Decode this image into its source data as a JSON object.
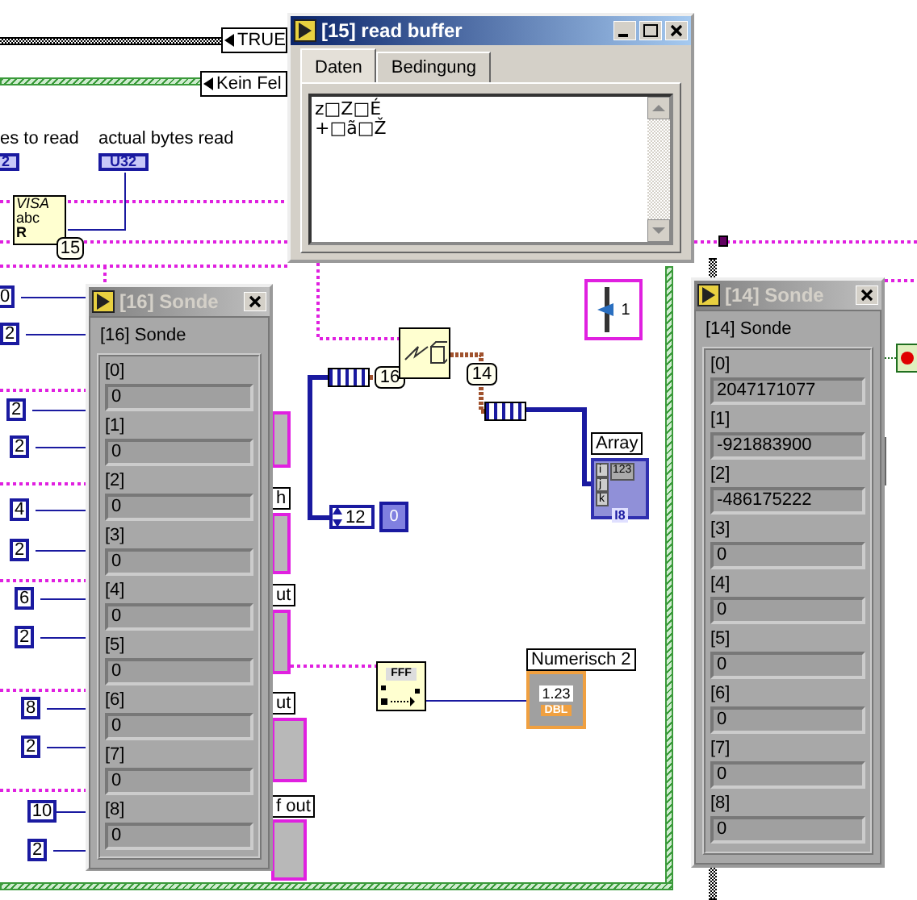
{
  "case_selectors": [
    {
      "label": "TRUE"
    },
    {
      "label": "Kein Fel"
    }
  ],
  "terminals": [
    {
      "label": "es to read",
      "value": "2"
    },
    {
      "label": "actual bytes read",
      "value": "U32"
    }
  ],
  "visa_read_node": {
    "lines": [
      "VISA",
      "abc",
      "R"
    ]
  },
  "probe_tags": [
    "15",
    "16",
    "14"
  ],
  "left_constants": [
    "0",
    "2",
    "2",
    "2",
    "4",
    "2",
    "6",
    "2",
    "8",
    "2",
    "10",
    "2"
  ],
  "string_indicator_labels": [
    "h",
    "ut",
    "ut",
    "f out"
  ],
  "slider_control": {
    "value": "1"
  },
  "numeric_control": {
    "value": "12",
    "index": "0"
  },
  "array_indicator": {
    "label": "Array",
    "value": "123",
    "indices": [
      "i",
      "j",
      "k"
    ],
    "type": "I8"
  },
  "format_node": {
    "text": "FFF"
  },
  "numeric_indicator": {
    "label": "Numerisch 2",
    "value": "1.23",
    "type": "DBL"
  },
  "probe_windows": [
    {
      "kind": "text",
      "title": "[15] read buffer",
      "active": true,
      "tabs": [
        {
          "label": "Daten",
          "selected": true
        },
        {
          "label": "Bedingung",
          "selected": false
        }
      ],
      "lines": [
        "z□Z□É",
        "+□ã□Ž"
      ]
    },
    {
      "kind": "array",
      "title": "[16] Sonde",
      "active": false,
      "caption": "[16] Sonde",
      "elements": [
        {
          "index": "[0]",
          "value": "0"
        },
        {
          "index": "[1]",
          "value": "0"
        },
        {
          "index": "[2]",
          "value": "0"
        },
        {
          "index": "[3]",
          "value": "0"
        },
        {
          "index": "[4]",
          "value": "0"
        },
        {
          "index": "[5]",
          "value": "0"
        },
        {
          "index": "[6]",
          "value": "0"
        },
        {
          "index": "[7]",
          "value": "0"
        },
        {
          "index": "[8]",
          "value": "0"
        }
      ]
    },
    {
      "kind": "array",
      "title": "[14] Sonde",
      "active": false,
      "caption": "[14] Sonde",
      "elements": [
        {
          "index": "[0]",
          "value": "2047171077"
        },
        {
          "index": "[1]",
          "value": "-921883900"
        },
        {
          "index": "[2]",
          "value": "-486175222"
        },
        {
          "index": "[3]",
          "value": "0"
        },
        {
          "index": "[4]",
          "value": "0"
        },
        {
          "index": "[5]",
          "value": "0"
        },
        {
          "index": "[6]",
          "value": "0"
        },
        {
          "index": "[7]",
          "value": "0"
        },
        {
          "index": "[8]",
          "value": "0"
        }
      ]
    }
  ]
}
